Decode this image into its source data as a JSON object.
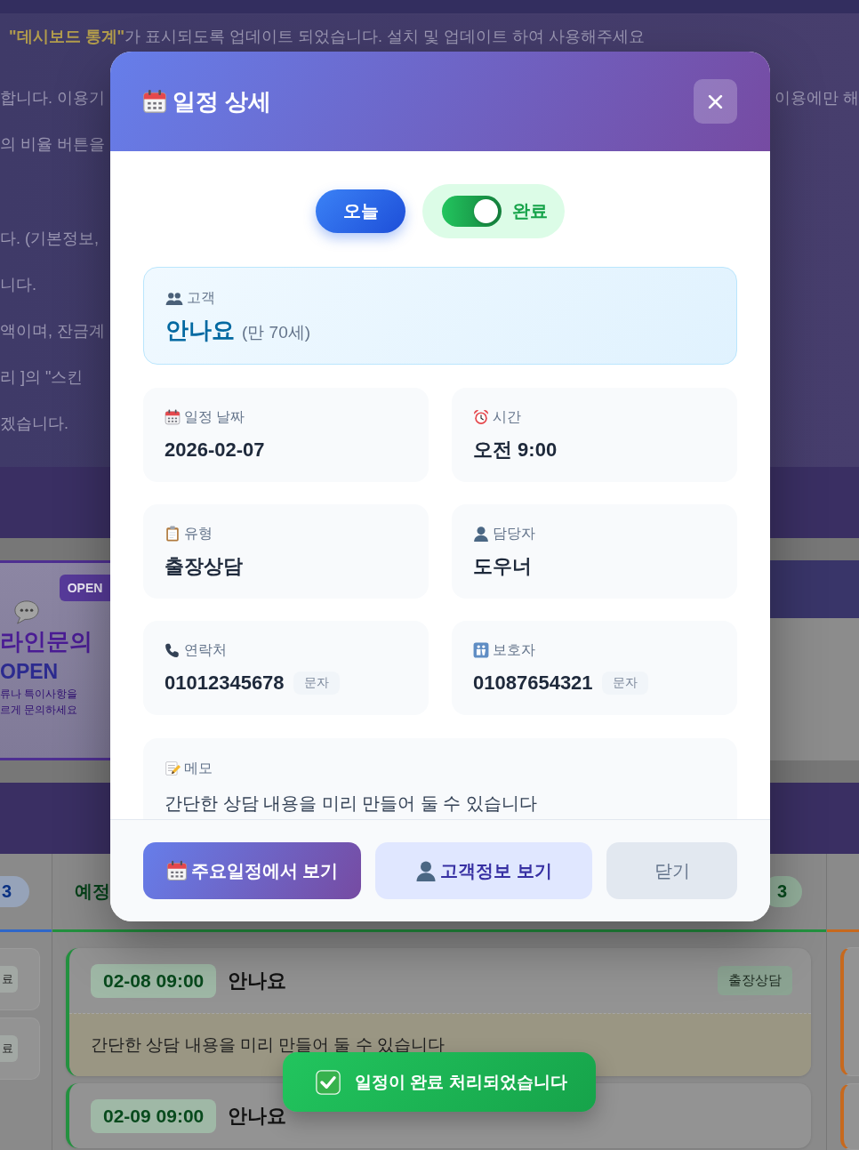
{
  "background": {
    "notice": {
      "paragraphs": [
        {
          "lines": [
            {
              "text": "**\"데시보드 통계\"**가 표시되도록 업데이트 되었습니다. 설치 및 업데이트 하여 사용해주세요"
            },
            {
              "text": "합니다. 이용기",
              "right_text": "이용에만 해"
            },
            {
              "text": "의 비율 버튼을"
            }
          ]
        },
        {
          "lines": [
            {
              "text": "다. (기본정보,"
            },
            {
              "text": "니다."
            },
            {
              "text": "액이며, 잔금계"
            },
            {
              "text": "리 ]의 \"스킨"
            },
            {
              "text": "겠습니다."
            }
          ]
        }
      ]
    },
    "promo_card": {
      "badge": "OPEN",
      "title": "라인문의",
      "subtitle": "OPEN",
      "lines": [
        "류나 특이사항을",
        "르게 문의하세요"
      ]
    },
    "board": {
      "columns": [
        {
          "badge": "3",
          "color": "#2f67c9",
          "cards": [
            {
              "kind": "edge",
              "status": "료"
            },
            {
              "kind": "edge",
              "status": "료"
            }
          ]
        },
        {
          "title": "예정",
          "badge": "3",
          "color": "#23913f",
          "cards": [
            {
              "kind": "full",
              "time": "02-08 09:00",
              "name": "안나요",
              "tag": "출장상담",
              "memo": "간단한 상담 내용을 미리 만들어 둘 수 있습니다"
            },
            {
              "kind": "full",
              "time": "02-09 09:00",
              "name": "안나요"
            }
          ]
        },
        {
          "color": "#c7691e",
          "cards": [
            {
              "kind": "edge"
            },
            {
              "kind": "edge"
            }
          ]
        }
      ]
    }
  },
  "modal": {
    "title": "일정 상세",
    "today_button": "오늘",
    "complete_toggle": {
      "label": "완료",
      "on": true
    },
    "customer": {
      "label": "고객",
      "name": "안나요",
      "age": "(만 70세)"
    },
    "fields": [
      {
        "kind": "date",
        "label": "일정 날짜",
        "value": "2026-02-07"
      },
      {
        "kind": "time",
        "label": "시간",
        "value": "오전 9:00"
      },
      {
        "kind": "type",
        "label": "유형",
        "value": "출장상담"
      },
      {
        "kind": "staff",
        "label": "담당자",
        "value": "도우너"
      },
      {
        "kind": "phone",
        "label": "연락처",
        "value": "01012345678",
        "action": {
          "label": "문자",
          "disabled": true
        }
      },
      {
        "kind": "guardian",
        "label": "보호자",
        "value": "01087654321",
        "action": {
          "label": "문자",
          "disabled": true
        }
      }
    ],
    "memo": {
      "label": "메모",
      "text": "간단한 상담 내용을 미리 만들어 둘 수 있습니다"
    },
    "footer_buttons": [
      {
        "kind": "primary",
        "label": "주요일정에서 보기"
      },
      {
        "kind": "secondary",
        "label": "고객정보 보기"
      },
      {
        "kind": "plain",
        "label": "닫기"
      }
    ]
  },
  "toast": {
    "text": "일정이 완료 처리되었습니다"
  }
}
